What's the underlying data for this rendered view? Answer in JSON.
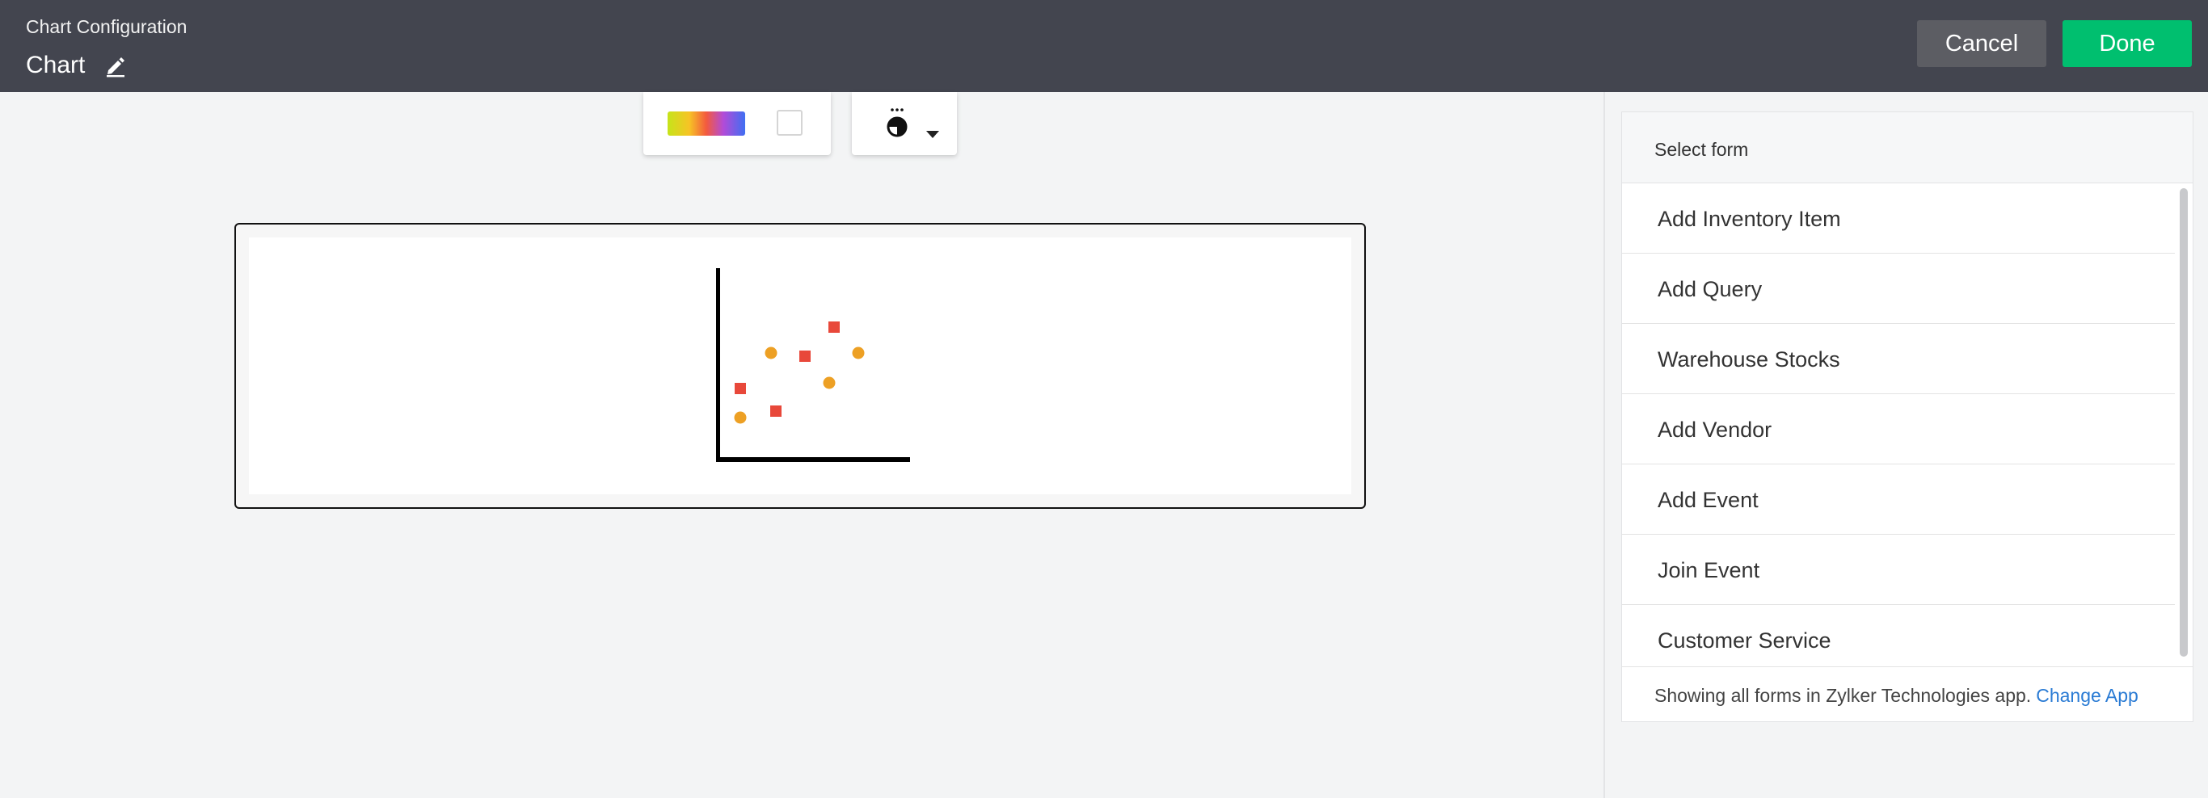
{
  "header": {
    "app_title": "Chart Configuration",
    "chart_name": "Chart",
    "edit_icon": "pencil-icon",
    "cancel_label": "Cancel",
    "done_label": "Done",
    "colors": {
      "bar_bg": "#43454f",
      "cancel_bg": "#5c5d63",
      "done_bg": "#00bf6f"
    }
  },
  "toolbar": {
    "color_palette_icon": "gradient-swatch",
    "background_icon": "white-swatch",
    "theme_icon": "contrast-icon",
    "dropdown_icon": "caret-down-icon"
  },
  "preview": {
    "placeholder_type": "scatter-icon",
    "marker_colors": {
      "square": "#e8483a",
      "circle": "#eda024"
    }
  },
  "form_panel": {
    "header_label": "Select form",
    "items": [
      {
        "label": "Add Inventory Item"
      },
      {
        "label": "Add Query"
      },
      {
        "label": "Warehouse Stocks"
      },
      {
        "label": "Add Vendor"
      },
      {
        "label": "Add Event"
      },
      {
        "label": "Join Event"
      },
      {
        "label": "Customer Service"
      }
    ],
    "footer_text": "Showing all forms in Zylker Technologies app.",
    "footer_link": "Change App"
  }
}
